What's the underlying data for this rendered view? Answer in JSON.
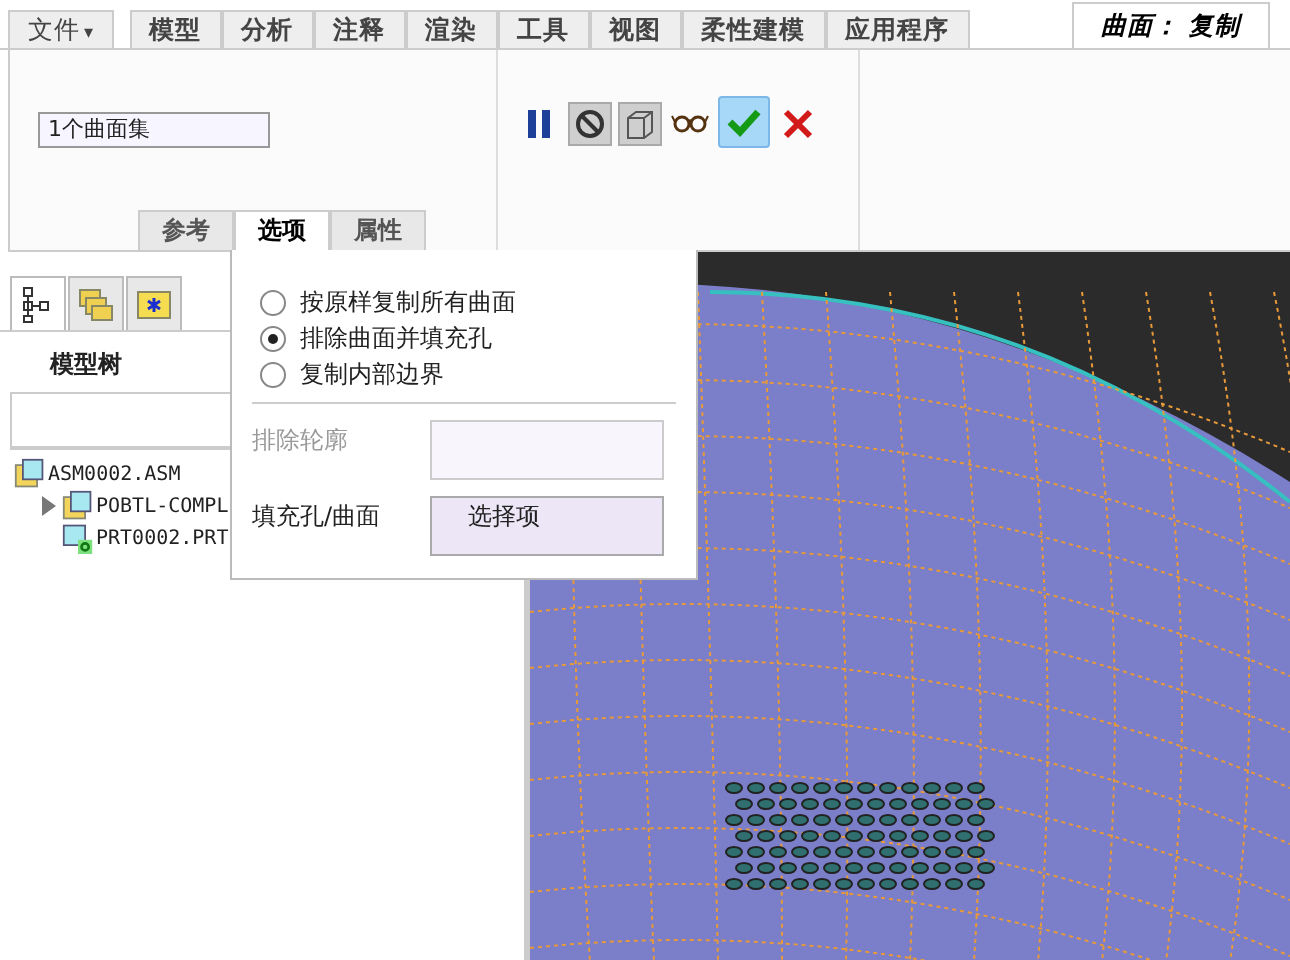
{
  "ribbon_tabs": [
    {
      "label": "文件",
      "caret": "▾",
      "selected": false
    },
    {
      "label": "模型",
      "selected": false
    },
    {
      "label": "分析",
      "selected": false
    },
    {
      "label": "注释",
      "selected": false
    },
    {
      "label": "渲染",
      "selected": false
    },
    {
      "label": "工具",
      "selected": false
    },
    {
      "label": "视图",
      "selected": false
    },
    {
      "label": "柔性建模",
      "selected": false
    },
    {
      "label": "应用程序",
      "selected": false
    },
    {
      "label": "曲面： 复制",
      "selected": true
    }
  ],
  "dashboard": {
    "collector": {
      "value": "1个曲面集"
    },
    "tools": [
      {
        "kind": "pause",
        "pressed": false
      },
      {
        "kind": "nosign",
        "pressed": true
      },
      {
        "kind": "preview",
        "pressed": true
      },
      {
        "kind": "glasses",
        "pressed": false
      },
      {
        "kind": "ok",
        "pressed": true
      },
      {
        "kind": "cancel",
        "pressed": false
      }
    ],
    "panel_tabs": [
      {
        "label": "参考",
        "selected": false
      },
      {
        "label": "选项",
        "selected": true
      },
      {
        "label": "属性",
        "selected": false
      }
    ]
  },
  "options_panel": {
    "radios": [
      {
        "label": "按原样复制所有曲面",
        "selected": false
      },
      {
        "label": "排除曲面并填充孔",
        "selected": true
      },
      {
        "label": "复制内部边界",
        "selected": false
      }
    ],
    "collectors": [
      {
        "label": "排除轮廓",
        "disabled": true
      },
      {
        "label": "填充孔/曲面",
        "value": "选择项",
        "disabled": false
      }
    ]
  },
  "navigator": {
    "tabs": [
      {
        "kind": "tree",
        "selected": true
      },
      {
        "kind": "folders",
        "selected": false
      },
      {
        "kind": "favorites",
        "selected": false
      }
    ],
    "title": "模型树",
    "tree": [
      {
        "label": "ASM0002.ASM",
        "kind": "assembly",
        "children": [
          {
            "label": "POBTL-COMPL",
            "kind": "assembly",
            "expanded": false
          },
          {
            "label": "PRT0002.PRT",
            "kind": "part"
          }
        ]
      }
    ]
  }
}
